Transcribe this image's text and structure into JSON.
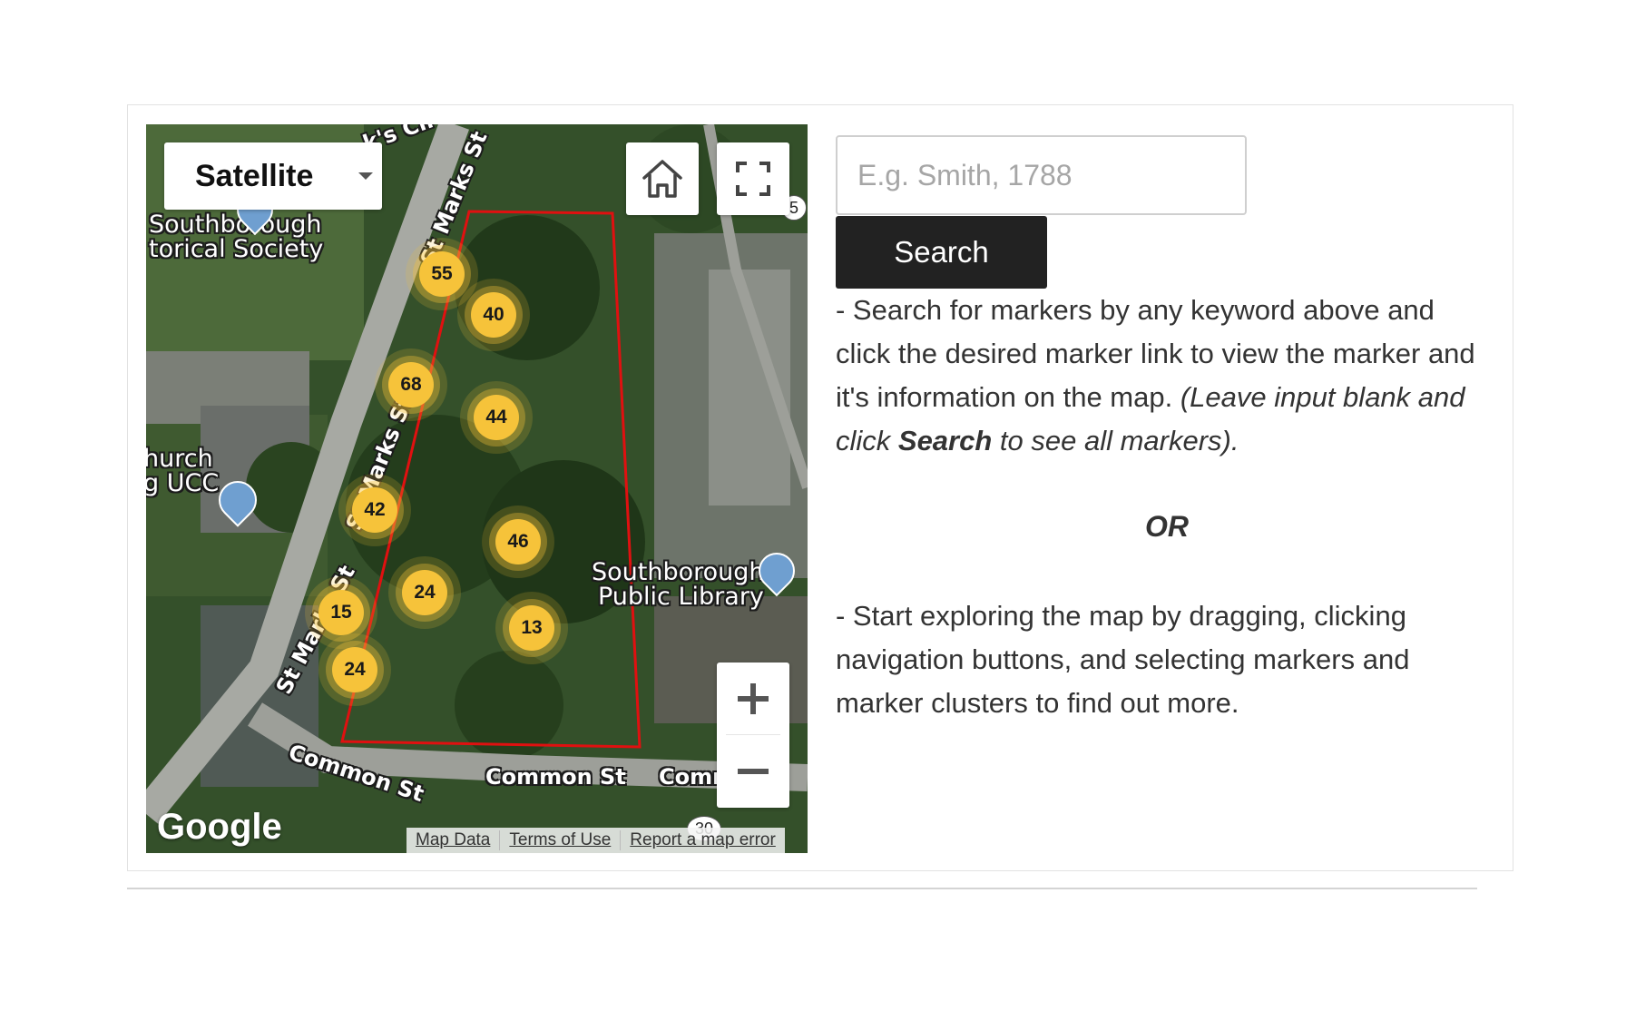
{
  "map": {
    "map_type": "Satellite",
    "home_icon": "home-icon",
    "fullscreen_icon": "fullscreen-icon",
    "zoom_in": "+",
    "zoom_out": "−",
    "clusters": [
      {
        "id": "c55",
        "count": "55"
      },
      {
        "id": "c40",
        "count": "40"
      },
      {
        "id": "c68",
        "count": "68"
      },
      {
        "id": "c44",
        "count": "44"
      },
      {
        "id": "c42",
        "count": "42"
      },
      {
        "id": "c46",
        "count": "46"
      },
      {
        "id": "c24a",
        "count": "24"
      },
      {
        "id": "c13",
        "count": "13"
      },
      {
        "id": "c15",
        "count": "15"
      },
      {
        "id": "c24b",
        "count": "24"
      }
    ],
    "places": {
      "historical_1": "Southborough",
      "historical_2": "torical Society",
      "church_1": "hurch",
      "church_2": "g UCC",
      "library_1": "Southborough",
      "library_2": "Public Library"
    },
    "roads": {
      "circle": "k's Cir",
      "st_marks_top": "St Marks St",
      "st_marks_mid": "St Marks St",
      "st_marks_low": "St Marks St",
      "common_left": "Common St",
      "common_mid": "Common St",
      "common_right": "Comn",
      "route_a": "5",
      "route_b": "30"
    },
    "logo": "Google",
    "footer": {
      "map_data": "Map Data",
      "terms": "Terms of Use",
      "report": "Report a map error"
    }
  },
  "search": {
    "placeholder": "E.g. Smith, 1788",
    "value": "",
    "button_label": "Search"
  },
  "instructions": {
    "part1": "- Search for markers by any keyword above and click the desired marker link to view the marker and it's information on the map. ",
    "part1_italic_a": "(Leave input blank and click ",
    "part1_bold": "Search",
    "part1_italic_b": " to see all markers).",
    "or": "OR",
    "part2": "- Start exploring the map by dragging, clicking navigation buttons, and selecting markers and marker clusters to find out more."
  },
  "colors": {
    "cluster": "#f6c33a",
    "boundary": "#e01010",
    "button": "#222222"
  }
}
